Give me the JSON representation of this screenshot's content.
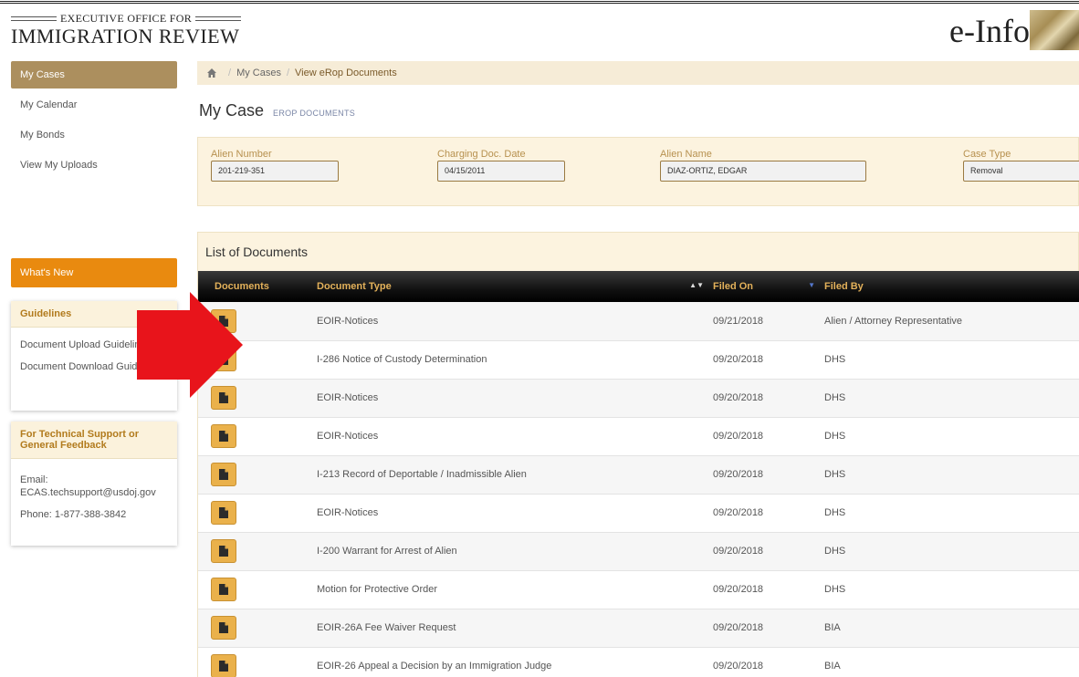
{
  "header": {
    "logo_top": "EXECUTIVE OFFICE FOR",
    "logo_main": "IMMIGRATION REVIEW",
    "app_title": "e-Info"
  },
  "sidebar": {
    "items": [
      {
        "label": "My Cases",
        "active": true
      },
      {
        "label": "My Calendar",
        "active": false
      },
      {
        "label": "My Bonds",
        "active": false
      },
      {
        "label": "View My Uploads",
        "active": false
      }
    ],
    "whats_new": "What's New",
    "guidelines": {
      "title": "Guidelines",
      "items": [
        "Document Upload Guidelines",
        "Document Download Guidelines"
      ]
    },
    "support": {
      "title": "For Technical Support or General Feedback",
      "email_label": "Email:",
      "email": "ECAS.techsupport@usdoj.gov",
      "phone": "Phone:  1-877-388-3842"
    }
  },
  "breadcrumb": {
    "items": [
      "My Cases",
      "View eRop Documents"
    ]
  },
  "page": {
    "title": "My Case",
    "subtitle": "EROP DOCUMENTS"
  },
  "case": {
    "alien_number_label": "Alien Number",
    "alien_number": "201-219-351",
    "charging_date_label": "Charging Doc. Date",
    "charging_date": "04/15/2011",
    "alien_name_label": "Alien Name",
    "alien_name": "DIAZ-ORTIZ, EDGAR",
    "case_type_label": "Case Type",
    "case_type": "Removal"
  },
  "documents": {
    "title": "List of Documents",
    "columns": [
      "Documents",
      "Document Type",
      "Filed On",
      "Filed By"
    ],
    "rows": [
      {
        "type": "EOIR-Notices",
        "filed_on": "09/21/2018",
        "filed_by": "Alien / Attorney Representative"
      },
      {
        "type": "I-286 Notice of Custody Determination",
        "filed_on": "09/20/2018",
        "filed_by": "DHS"
      },
      {
        "type": "EOIR-Notices",
        "filed_on": "09/20/2018",
        "filed_by": "DHS"
      },
      {
        "type": "EOIR-Notices",
        "filed_on": "09/20/2018",
        "filed_by": "DHS"
      },
      {
        "type": "I-213 Record of Deportable / Inadmissible Alien",
        "filed_on": "09/20/2018",
        "filed_by": "DHS"
      },
      {
        "type": "EOIR-Notices",
        "filed_on": "09/20/2018",
        "filed_by": "DHS"
      },
      {
        "type": "I-200 Warrant for Arrest of Alien",
        "filed_on": "09/20/2018",
        "filed_by": "DHS"
      },
      {
        "type": "Motion for Protective Order",
        "filed_on": "09/20/2018",
        "filed_by": "DHS"
      },
      {
        "type": "EOIR-26A Fee Waiver Request",
        "filed_on": "09/20/2018",
        "filed_by": "BIA"
      },
      {
        "type": "EOIR-26 Appeal a Decision by an Immigration Judge",
        "filed_on": "09/20/2018",
        "filed_by": "BIA"
      }
    ]
  },
  "colors": {
    "accent_tan": "#ac8f5e",
    "orange": "#e98a0f",
    "doc_button": "#eab14b",
    "arrow": "#e8141b"
  },
  "icons": {
    "home": "home-icon",
    "document": "document-icon",
    "arrow": "red-arrow-annotation"
  }
}
